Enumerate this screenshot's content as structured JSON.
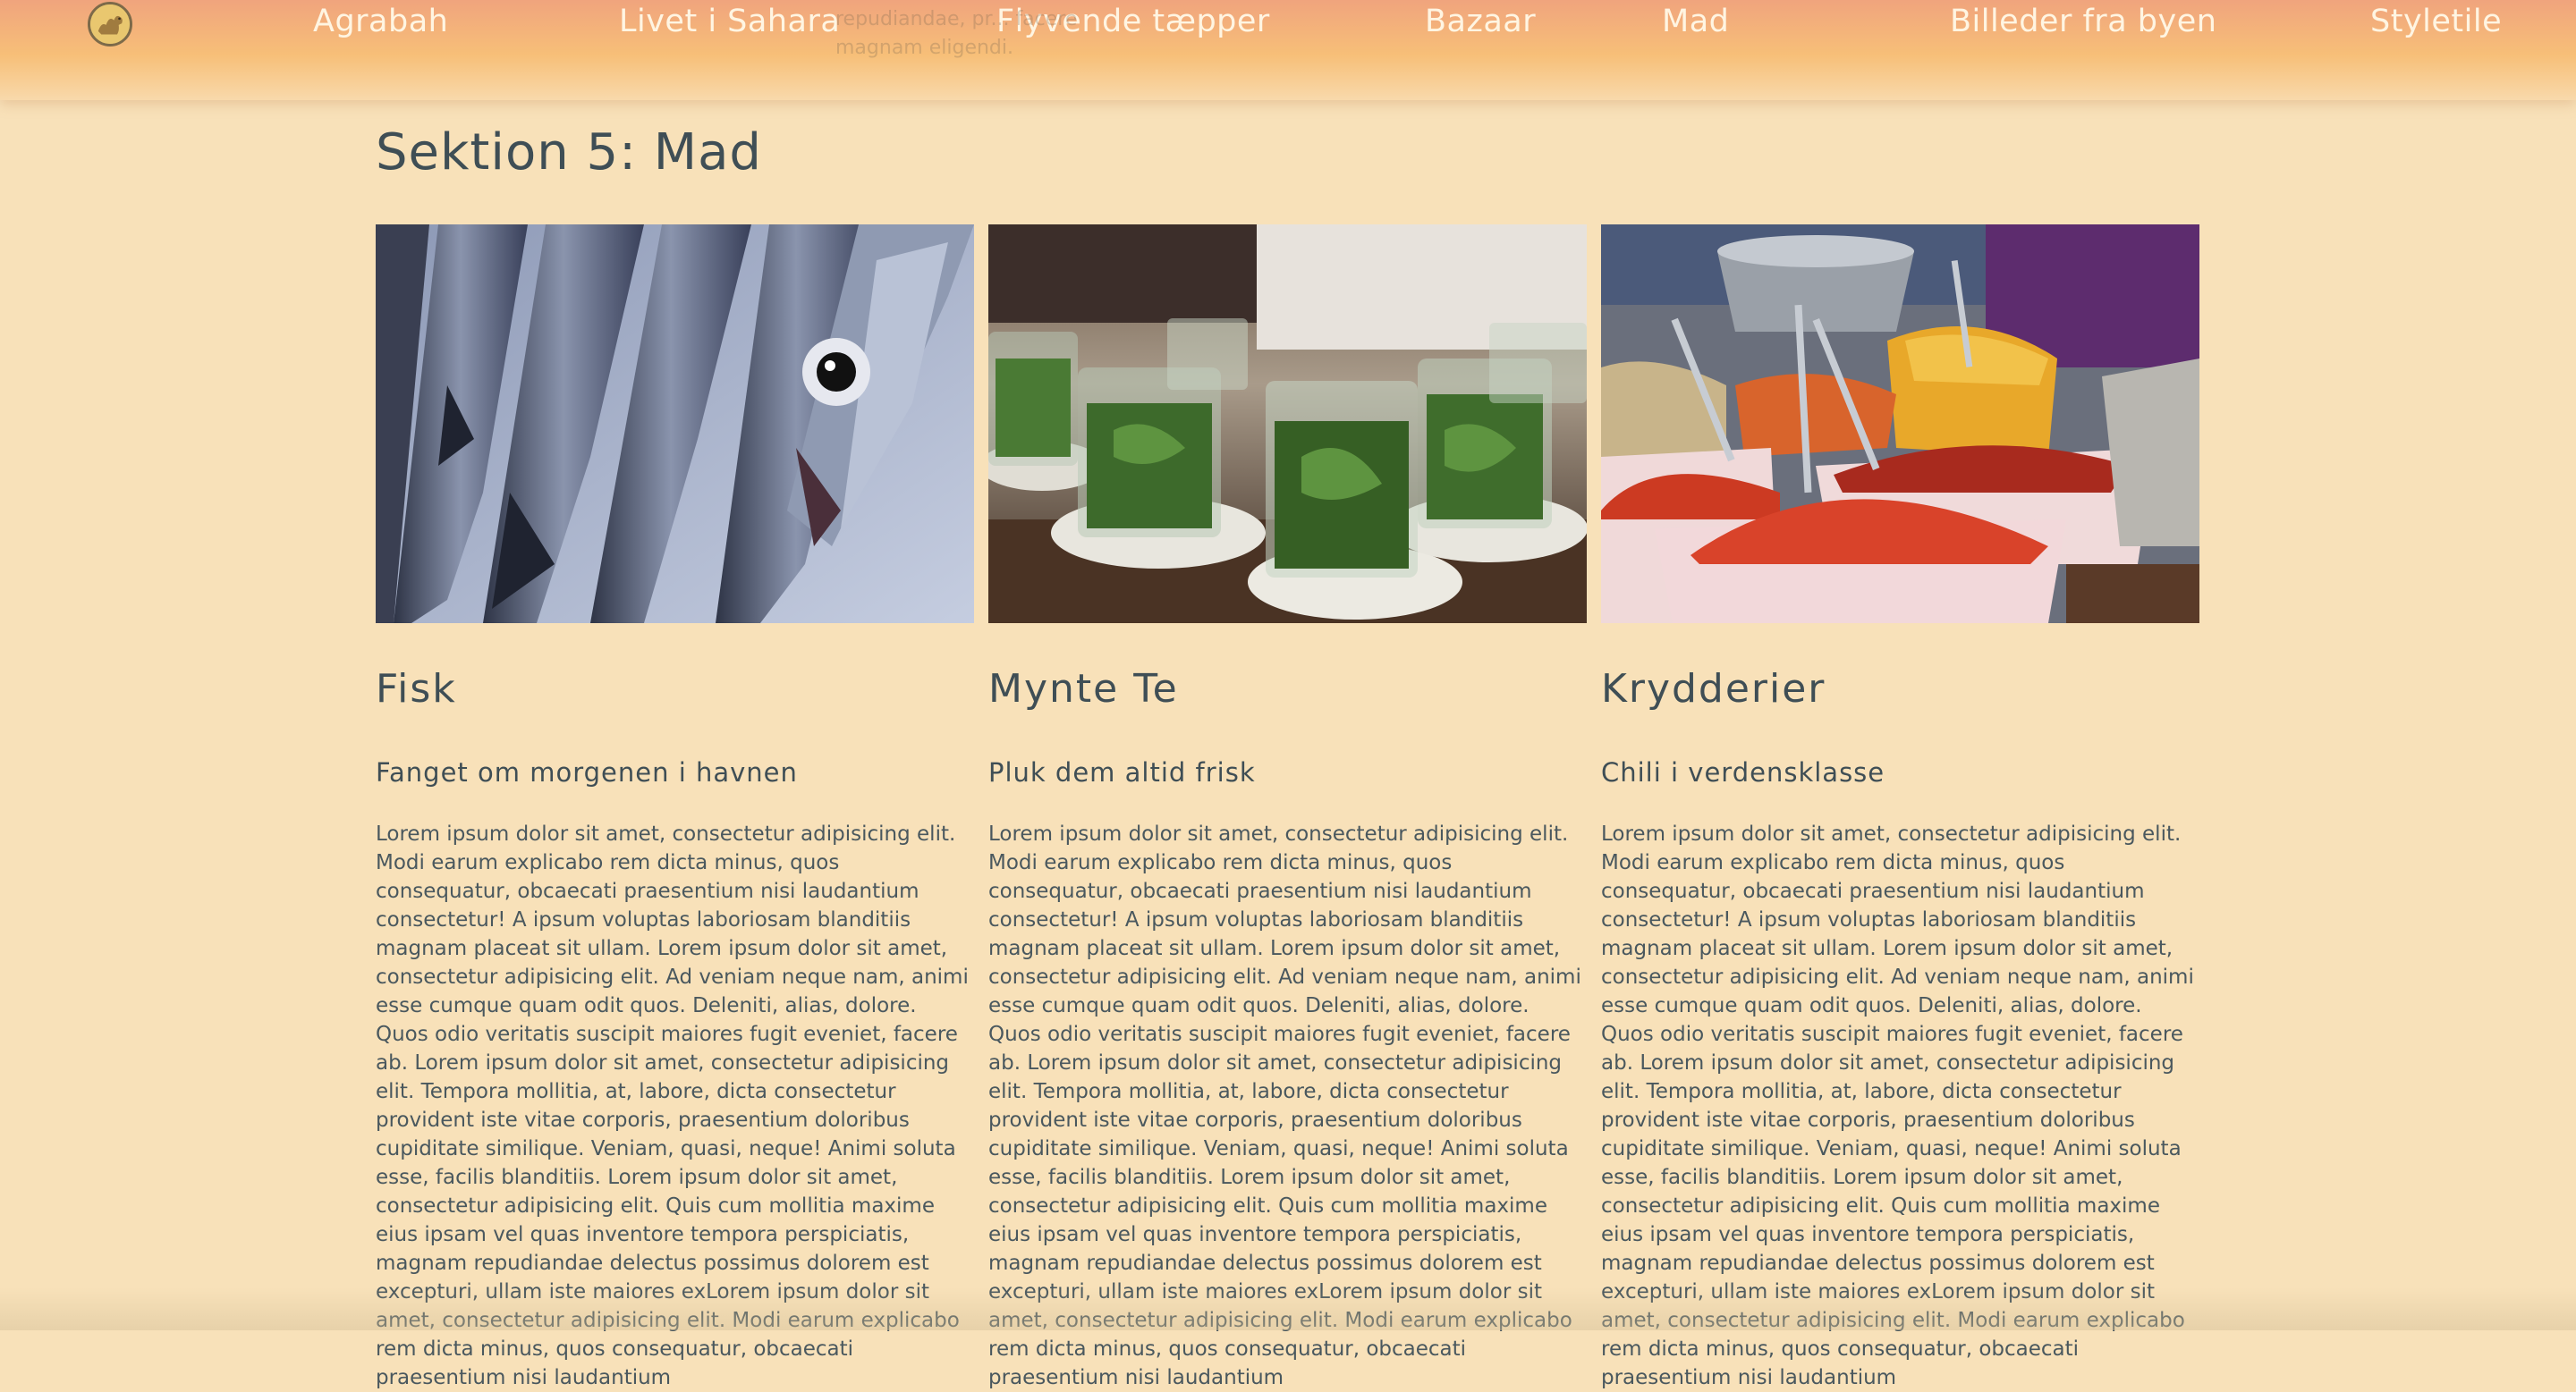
{
  "nav": {
    "items": [
      {
        "label": "Agrabah"
      },
      {
        "label": "Livet i Sahara"
      },
      {
        "label": "Flyvende tæpper"
      },
      {
        "label": "Bazaar"
      },
      {
        "label": "Mad"
      },
      {
        "label": "Billeder fra byen"
      },
      {
        "label": "Styletile"
      }
    ],
    "ghost_text": "repudiandae, pr... facere magnam eligendi."
  },
  "section": {
    "title": "Sektion 5: Mad"
  },
  "cards": [
    {
      "image": "fish-photo",
      "title": "Fisk",
      "subtitle": "Fanget om morgenen i havnen",
      "body": "Lorem ipsum dolor sit amet, consectetur adipisicing elit. Modi earum explicabo rem dicta minus, quos consequatur, obcaecati praesentium nisi laudantium consectetur! A ipsum voluptas laboriosam blanditiis magnam placeat sit ullam. Lorem ipsum dolor sit amet, consectetur adipisicing elit. Ad veniam neque nam, animi esse cumque quam odit quos. Deleniti, alias, dolore. Quos odio veritatis suscipit maiores fugit eveniet, facere ab. Lorem ipsum dolor sit amet, consectetur adipisicing elit. Tempora mollitia, at, labore, dicta consectetur provident iste vitae corporis, praesentium doloribus cupiditate similique. Veniam, quasi, neque! Animi soluta esse, facilis blanditiis. Lorem ipsum dolor sit amet, consectetur adipisicing elit. Quis cum mollitia maxime eius ipsam vel quas inventore tempora perspiciatis, magnam repudiandae delectus possimus dolorem est excepturi, ullam iste maiores exLorem ipsum dolor sit amet, consectetur adipisicing elit. Modi earum explicabo rem dicta minus, quos consequatur, obcaecati praesentium nisi laudantium"
    },
    {
      "image": "mint-tea-photo",
      "title": "Mynte Te",
      "subtitle": "Pluk dem altid frisk",
      "body": "Lorem ipsum dolor sit amet, consectetur adipisicing elit. Modi earum explicabo rem dicta minus, quos consequatur, obcaecati praesentium nisi laudantium consectetur! A ipsum voluptas laboriosam blanditiis magnam placeat sit ullam. Lorem ipsum dolor sit amet, consectetur adipisicing elit. Ad veniam neque nam, animi esse cumque quam odit quos. Deleniti, alias, dolore. Quos odio veritatis suscipit maiores fugit eveniet, facere ab. Lorem ipsum dolor sit amet, consectetur adipisicing elit. Tempora mollitia, at, labore, dicta consectetur provident iste vitae corporis, praesentium doloribus cupiditate similique. Veniam, quasi, neque! Animi soluta esse, facilis blanditiis. Lorem ipsum dolor sit amet, consectetur adipisicing elit. Quis cum mollitia maxime eius ipsam vel quas inventore tempora perspiciatis, magnam repudiandae delectus possimus dolorem est excepturi, ullam iste maiores exLorem ipsum dolor sit amet, consectetur adipisicing elit. Modi earum explicabo rem dicta minus, quos consequatur, obcaecati praesentium nisi laudantium"
    },
    {
      "image": "spices-photo",
      "title": "Krydderier",
      "subtitle": "Chili i verdensklasse",
      "body": "Lorem ipsum dolor sit amet, consectetur adipisicing elit. Modi earum explicabo rem dicta minus, quos consequatur, obcaecati praesentium nisi laudantium consectetur! A ipsum voluptas laboriosam blanditiis magnam placeat sit ullam. Lorem ipsum dolor sit amet, consectetur adipisicing elit. Ad veniam neque nam, animi esse cumque quam odit quos. Deleniti, alias, dolore. Quos odio veritatis suscipit maiores fugit eveniet, facere ab. Lorem ipsum dolor sit amet, consectetur adipisicing elit. Tempora mollitia, at, labore, dicta consectetur provident iste vitae corporis, praesentium doloribus cupiditate similique. Veniam, quasi, neque! Animi soluta esse, facilis blanditiis. Lorem ipsum dolor sit amet, consectetur adipisicing elit. Quis cum mollitia maxime eius ipsam vel quas inventore tempora perspiciatis, magnam repudiandae delectus possimus dolorem est excepturi, ullam iste maiores exLorem ipsum dolor sit amet, consectetur adipisicing elit. Modi earum explicabo rem dicta minus, quos consequatur, obcaecati praesentium nisi laudantium"
    }
  ],
  "colors": {
    "page_background": "#f8e1b9",
    "nav_gradient_top": "#f0a47d",
    "nav_gradient_bottom": "#f7bf78",
    "nav_text": "#fff5e2",
    "heading_text": "#3f4e55"
  }
}
